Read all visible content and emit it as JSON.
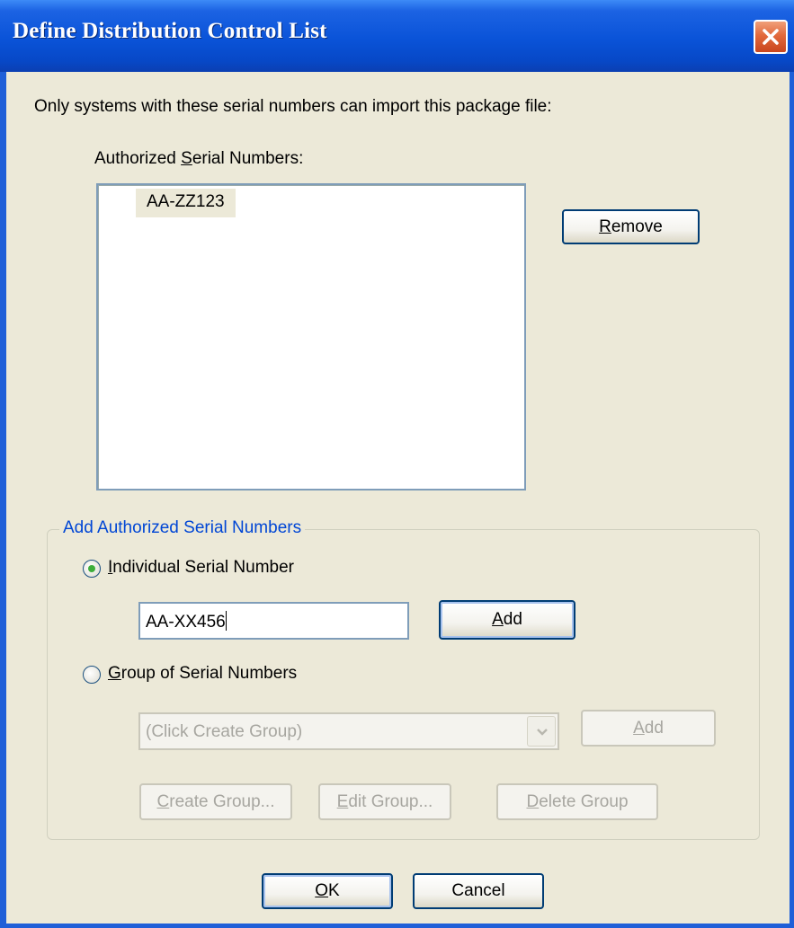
{
  "window": {
    "title": "Define Distribution Control List"
  },
  "intro_text": "Only systems with these serial numbers can import this package file:",
  "authorized": {
    "label_pre": "Authorized ",
    "label_u": "S",
    "label_post": "erial Numbers:",
    "items": [
      "AA-ZZ123"
    ]
  },
  "remove_button": {
    "u": "R",
    "rest": "emove"
  },
  "add_group": {
    "legend": "Add Authorized Serial Numbers",
    "individual": {
      "u": "I",
      "rest": "ndividual Serial Number",
      "selected": true
    },
    "serial_input_value": "AA-XX456",
    "add_button": {
      "u": "A",
      "rest": "dd"
    },
    "group_option": {
      "u": "G",
      "rest": "roup of Serial Numbers",
      "selected": false
    },
    "group_combo_value": "(Click Create Group)",
    "group_add_button": {
      "u": "A",
      "rest": "dd"
    },
    "create_group": {
      "u": "C",
      "rest": "reate Group..."
    },
    "edit_group": {
      "u": "E",
      "rest": "dit Group..."
    },
    "delete_group": {
      "u": "D",
      "rest": "elete Group"
    }
  },
  "ok_button": {
    "u": "O",
    "rest": "K"
  },
  "cancel_button": "Cancel",
  "colors": {
    "titlebar": "#0A53D8",
    "dialog_bg": "#ECE9D8",
    "group_legend": "#0046D5",
    "close": "#E2693C"
  }
}
